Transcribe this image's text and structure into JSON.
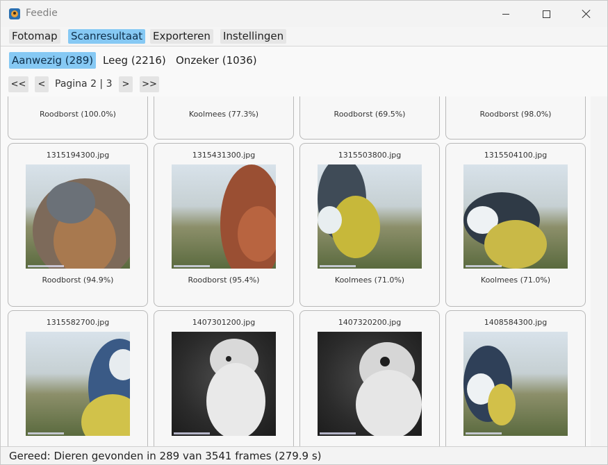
{
  "window": {
    "title": "Feedie",
    "icon": "bird-app-icon"
  },
  "tabs": [
    {
      "label": "Fotomap",
      "active": false
    },
    {
      "label": "Scanresultaat",
      "active": true
    },
    {
      "label": "Exporteren",
      "active": false
    },
    {
      "label": "Instellingen",
      "active": false
    }
  ],
  "subtabs": [
    {
      "label": "Aanwezig (289)",
      "active": true
    },
    {
      "label": "Leeg (2216)",
      "active": false
    },
    {
      "label": "Onzeker (1036)",
      "active": false
    }
  ],
  "pager": {
    "first": "<<",
    "prev": "<",
    "label": "Pagina 2 | 3",
    "next": ">",
    "last": ">>"
  },
  "partial_row": [
    "Roodborst (100.0%)",
    "Koolmees (77.3%)",
    "Roodborst (69.5%)",
    "Roodborst (98.0%)"
  ],
  "cards": [
    {
      "file": "1315194300.jpg",
      "label": "Roodborst (94.9%)",
      "scene": "day"
    },
    {
      "file": "1315431300.jpg",
      "label": "Roodborst (95.4%)",
      "scene": "day"
    },
    {
      "file": "1315503800.jpg",
      "label": "Koolmees (71.0%)",
      "scene": "day"
    },
    {
      "file": "1315504100.jpg",
      "label": "Koolmees (71.0%)",
      "scene": "day"
    },
    {
      "file": "1315582700.jpg",
      "label": "",
      "scene": "day"
    },
    {
      "file": "1407301200.jpg",
      "label": "",
      "scene": "night"
    },
    {
      "file": "1407320200.jpg",
      "label": "",
      "scene": "night"
    },
    {
      "file": "1408584300.jpg",
      "label": "",
      "scene": "day"
    }
  ],
  "status": "Gereed: Dieren gevonden in 289 van 3541 frames (279.9 s)",
  "colors": {
    "accent": "#86c9f4",
    "tab_bg": "#e6e6e6",
    "card_border": "#b9b9b9"
  }
}
